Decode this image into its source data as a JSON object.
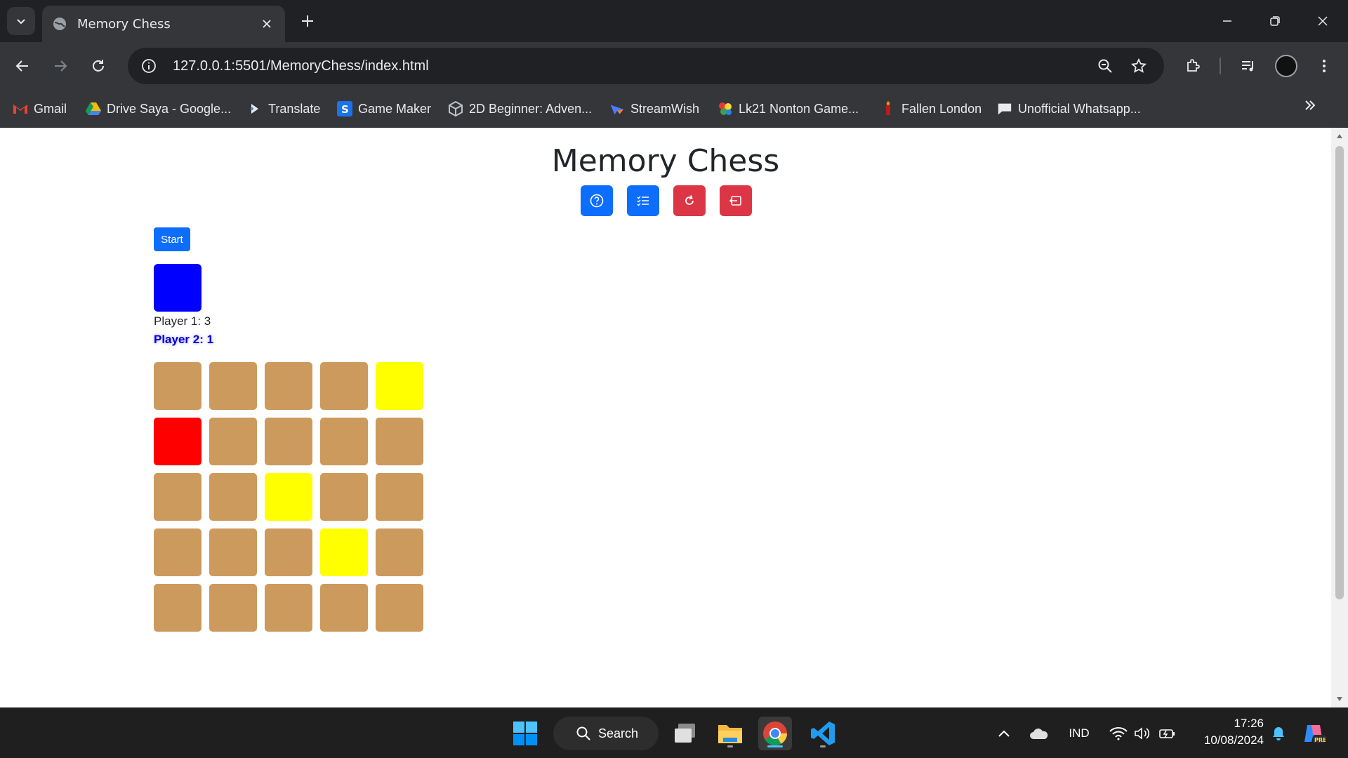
{
  "browser": {
    "tab_title": "Memory Chess",
    "url": "127.0.0.1:5501/MemoryChess/index.html",
    "bookmarks": [
      {
        "label": "Gmail",
        "icon": "gmail-icon"
      },
      {
        "label": "Drive Saya - Google...",
        "icon": "google-drive-icon"
      },
      {
        "label": "Translate",
        "icon": "translate-icon"
      },
      {
        "label": "Game Maker",
        "icon": "game-maker-icon"
      },
      {
        "label": "2D Beginner: Adven...",
        "icon": "unity-icon"
      },
      {
        "label": "StreamWish",
        "icon": "streamwish-icon"
      },
      {
        "label": "Lk21 Nonton Game...",
        "icon": "lk21-icon"
      },
      {
        "label": "Fallen London",
        "icon": "fallen-london-icon"
      },
      {
        "label": "Unofficial Whatsapp...",
        "icon": "chat-icon"
      }
    ]
  },
  "page": {
    "title": "Memory Chess",
    "actions": [
      {
        "name": "help-button",
        "icon": "question-circle-icon",
        "color": "#0d6efd"
      },
      {
        "name": "leaderboard-button",
        "icon": "list-check-icon",
        "color": "#0d6efd"
      },
      {
        "name": "restart-button",
        "icon": "refresh-icon",
        "color": "#dc3545"
      },
      {
        "name": "exit-button",
        "icon": "exit-icon",
        "color": "#dc3545"
      }
    ],
    "start_label": "Start",
    "turn_color": "#0000ff",
    "players": {
      "p1": "Player 1: 3",
      "p2": "Player 2: 1"
    },
    "board": {
      "rows": 5,
      "cols": 5,
      "cells": [
        "#cc9a5c",
        "#cc9a5c",
        "#cc9a5c",
        "#cc9a5c",
        "#ffff00",
        "#ff0000",
        "#cc9a5c",
        "#cc9a5c",
        "#cc9a5c",
        "#cc9a5c",
        "#cc9a5c",
        "#cc9a5c",
        "#ffff00",
        "#cc9a5c",
        "#cc9a5c",
        "#cc9a5c",
        "#cc9a5c",
        "#cc9a5c",
        "#ffff00",
        "#cc9a5c",
        "#cc9a5c",
        "#cc9a5c",
        "#cc9a5c",
        "#cc9a5c",
        "#cc9a5c"
      ]
    }
  },
  "taskbar": {
    "search_label": "Search",
    "language": "IND",
    "time": "17:26",
    "date": "10/08/2024"
  }
}
